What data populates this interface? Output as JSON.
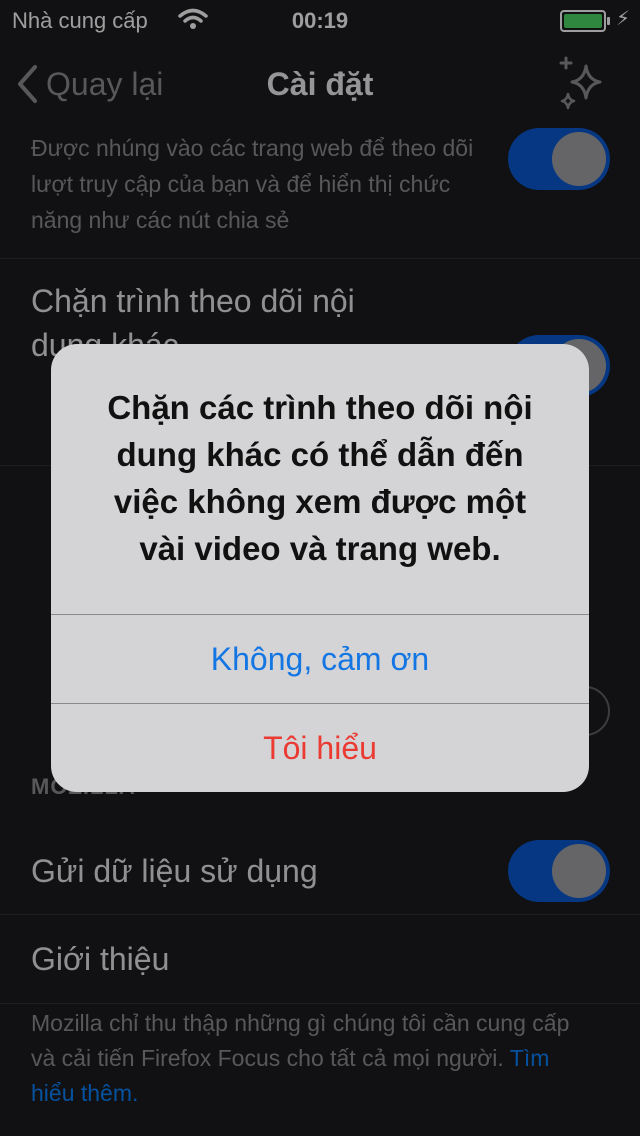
{
  "status_bar": {
    "carrier": "Nhà cung cấp",
    "time": "00:19"
  },
  "nav": {
    "back_label": "Quay lại",
    "title": "Cài đặt",
    "right_icon": "sparkle-icon"
  },
  "settings": {
    "social_desc": "Được nhúng vào các trang web để theo dõi lượt truy cập của bạn và để hiển thị chức năng như các nút chia sẻ",
    "social_toggle": true,
    "other_label": "Chặn trình theo dõi nội dung khác",
    "other_toggle": true,
    "mozilla_header": "MOZILLA",
    "usage_label": "Gửi dữ liệu sử dụng",
    "usage_toggle": true,
    "about_label": "Giới thiệu",
    "footer_text": "Mozilla chỉ thu thập những gì chúng tôi cần cung cấp và cải tiến Firefox Focus cho tất cả mọi người.",
    "footer_link": "Tìm hiểu thêm."
  },
  "alert": {
    "message": "Chặn các trình theo dõi nội dung khác có thể dẫn đến việc không xem được một vài video và trang web.",
    "cancel_label": "Không, cảm ơn",
    "confirm_label": "Tôi hiểu"
  },
  "colors": {
    "toggle_on": "#0a59d4",
    "link": "#1476e3",
    "destructive": "#ea3a32",
    "battery": "#4cd964"
  }
}
